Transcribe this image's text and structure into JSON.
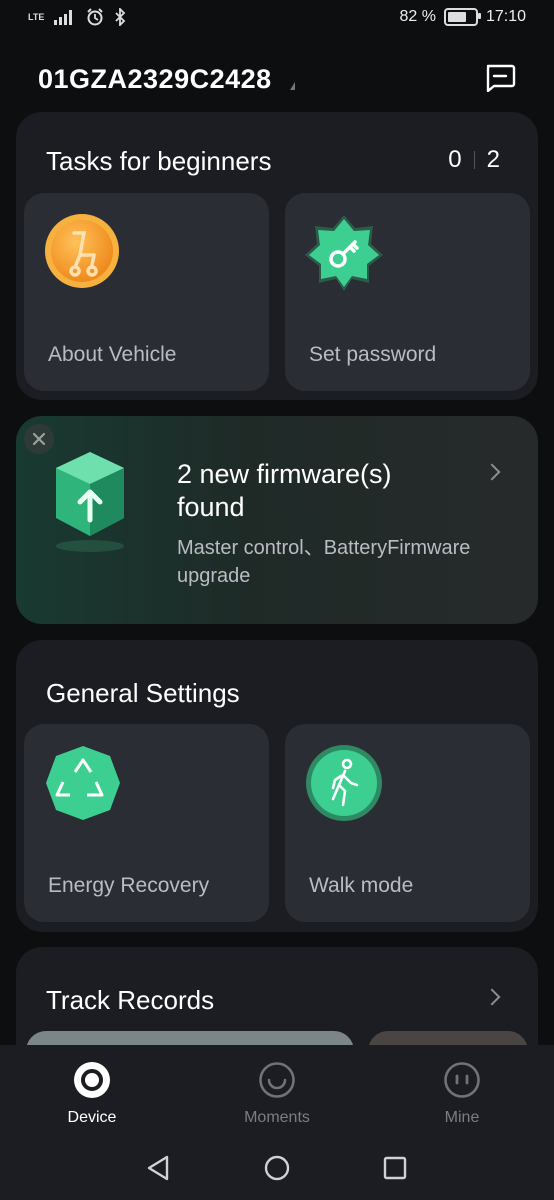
{
  "status": {
    "network": "LTE",
    "battery": "82 %",
    "time": "17:10",
    "battery_level": 0.82
  },
  "header": {
    "device_id": "01GZA2329C2428"
  },
  "tasks": {
    "title": "Tasks for beginners",
    "completed": "0",
    "total": "2",
    "items": [
      {
        "label": "About Vehicle",
        "icon": "scooter-badge-icon"
      },
      {
        "label": "Set password",
        "icon": "key-badge-icon"
      }
    ]
  },
  "firmware": {
    "title": "2 new firmware(s) found",
    "subtitle": "Master control、BatteryFirmware upgrade"
  },
  "general_settings": {
    "title": "General Settings",
    "items": [
      {
        "label": "Energy Recovery",
        "icon": "recycle-icon"
      },
      {
        "label": "Walk mode",
        "icon": "walking-person-icon"
      }
    ]
  },
  "track_records": {
    "title": "Track Records"
  },
  "bottom_nav": {
    "items": [
      {
        "label": "Device",
        "active": true
      },
      {
        "label": "Moments",
        "active": false
      },
      {
        "label": "Mine",
        "active": false
      }
    ]
  },
  "colors": {
    "accent_green": "#3ccf91",
    "orange": "#f39a24",
    "background": "#0d0e10"
  }
}
